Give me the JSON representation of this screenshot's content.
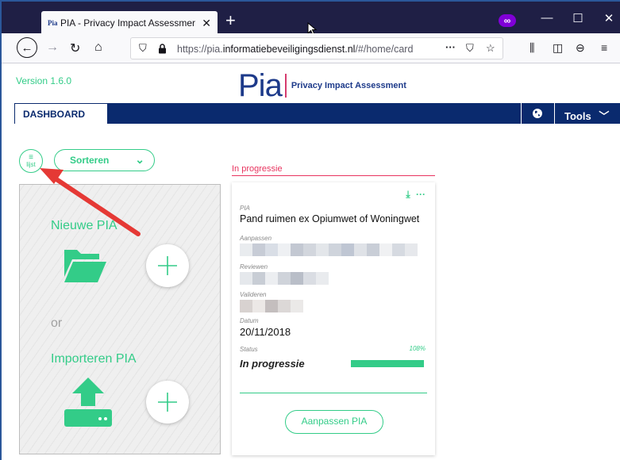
{
  "browser": {
    "tab": {
      "favicon_text": "Pia",
      "title": "PIA - Privacy Impact Assessmer"
    },
    "url": {
      "prefix": "https://pia.",
      "domain": "informatiebeveiligingsdienst.nl",
      "path": "/#/home/card"
    },
    "icons": [
      "back-icon",
      "forward-icon",
      "reload-icon",
      "home-icon",
      "shield-icon",
      "lock-icon",
      "more-icon",
      "pocket-icon",
      "bookmark-star-icon",
      "library-icon",
      "sidebar-icon",
      "account-icon",
      "menu-icon",
      "private-browsing-icon"
    ]
  },
  "app": {
    "version": "Version 1.6.0",
    "logo_word": "Pia",
    "logo_text": "Privacy Impact Assessment",
    "menu": {
      "dashboard": "DASHBOARD",
      "tools": "Tools"
    },
    "list_button": "lijst",
    "sort_button": "Sorteren",
    "new_pia": "Nieuwe PIA",
    "or": "or",
    "import_pia": "Importeren PIA"
  },
  "section": {
    "label": "In progressie"
  },
  "card": {
    "pia_label": "PIA",
    "pia_name": "Pand ruimen ex Opiumwet of Woningwet",
    "editor_label": "Aanpassen",
    "reviewer_label": "Reviewen",
    "validator_label": "Valideren",
    "date_label": "Datum",
    "date": "20/11/2018",
    "status_label": "Status",
    "status": "In progressie",
    "progress_text": "108%",
    "progress": 1.0,
    "edit_button": "Aanpassen PIA"
  },
  "colors": {
    "accent": "#33cc88",
    "navy": "#0a2a6e",
    "alert": "#e8345f"
  }
}
